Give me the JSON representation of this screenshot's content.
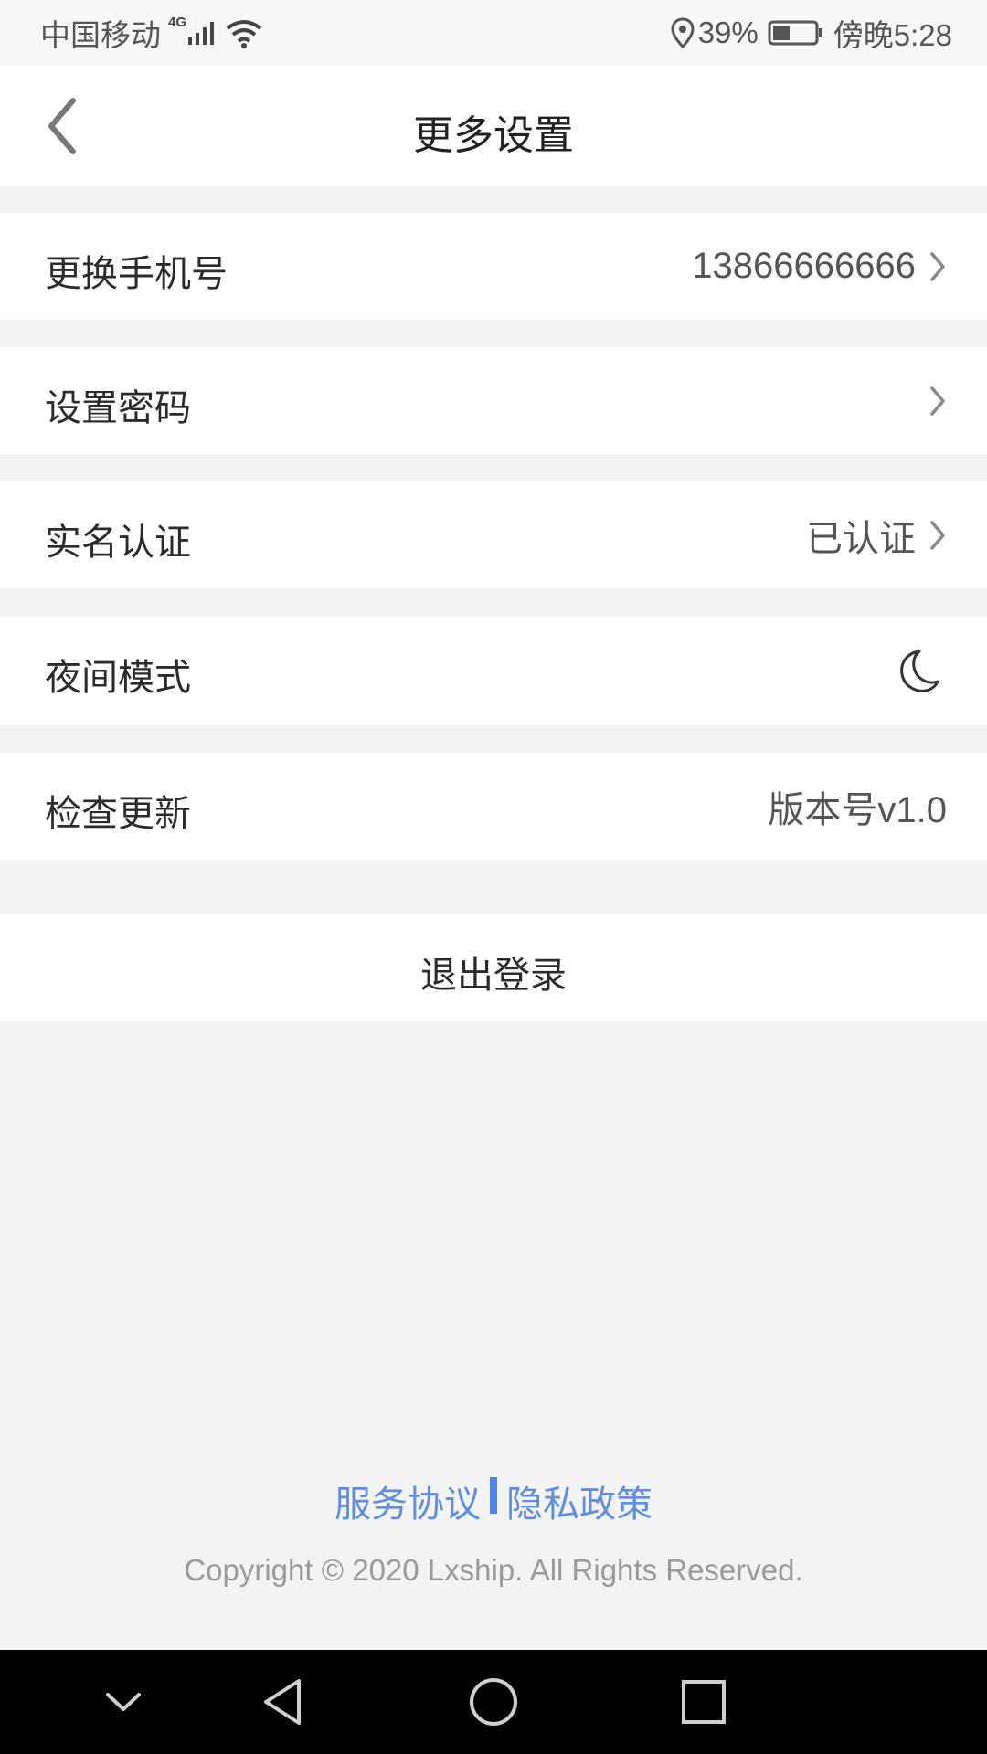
{
  "status_bar": {
    "carrier": "中国移动",
    "network": "4G",
    "battery": "39%",
    "time": "傍晚5:28"
  },
  "header": {
    "title": "更多设置",
    "back_icon": "chevron-left-icon"
  },
  "settings": {
    "phone": {
      "label": "更换手机号",
      "value": "13866666666"
    },
    "password": {
      "label": "设置密码",
      "value": ""
    },
    "realname": {
      "label": "实名认证",
      "value": "已认证"
    },
    "night_mode": {
      "label": "夜间模式",
      "icon": "moon-icon"
    },
    "update": {
      "label": "检查更新",
      "value": "版本号v1.0"
    }
  },
  "logout": {
    "label": "退出登录"
  },
  "footer": {
    "service_link": "服务协议",
    "privacy_link": "隐私政策",
    "copyright": "Copyright © 2020 Lxship. All Rights Reserved."
  },
  "colors": {
    "link": "#5e8ede",
    "background": "#f3f3f3",
    "row": "#ffffff"
  }
}
